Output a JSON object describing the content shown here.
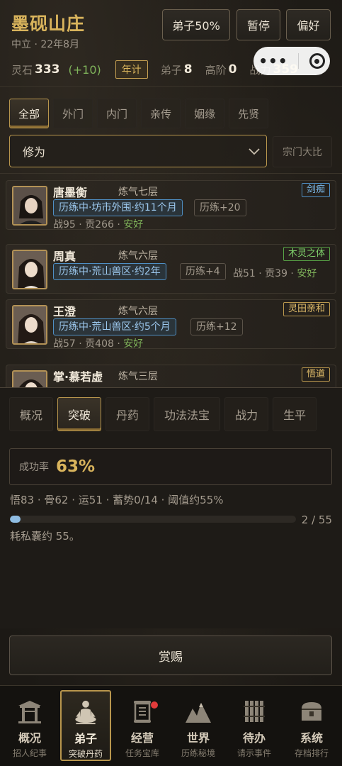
{
  "header": {
    "sect_name": "墨砚山庄",
    "subtitle": "中立 · 22年8月",
    "buttons": {
      "disciple_pct": "弟子50%",
      "pause": "暂停",
      "prefs": "偏好"
    },
    "resources": {
      "spirit_stone_label": "灵石",
      "spirit_stone_value": "333",
      "income": "(+10)",
      "yearly_btn": "年计",
      "disciple_label": "弟子",
      "disciple_value": "8",
      "senior_label": "高阶",
      "senior_value": "0",
      "power_label": "战力",
      "power_value": "359"
    },
    "capsule": {
      "more_icon": "more-dots-icon",
      "close_icon": "target-close-icon"
    }
  },
  "filter_tabs": [
    "全部",
    "外门",
    "内门",
    "亲传",
    "姻缘",
    "先贤"
  ],
  "filter_active": 0,
  "sort": {
    "value": "修为",
    "compare_btn": "宗门大比"
  },
  "disciples": [
    {
      "name": "唐墨衡",
      "realm": "炼气七层",
      "trait": "剑痴",
      "trait_color": "#7ab8e8",
      "status": "历练中·坊市外围·约11个月",
      "train": "历练+20",
      "stats": "战95 · 贡266 · ",
      "mood": "安好"
    },
    {
      "name": "周真",
      "realm": "炼气六层",
      "trait": "木灵之体",
      "trait_color": "#7fcf6a",
      "status": "历练中·荒山兽区·约2年",
      "train": "历练+4",
      "stats": "战51 · 贡39 · ",
      "mood": "安好"
    },
    {
      "name": "王澄",
      "realm": "炼气六层",
      "trait": "灵田亲和",
      "trait_color": "#e2bd6a",
      "status": "历练中·荒山兽区·约5个月",
      "train": "历练+12",
      "stats": "战57 · 贡408 · ",
      "mood": "安好"
    },
    {
      "name": "掌·慕若虚",
      "realm": "炼气三层",
      "trait": "悟道",
      "trait_color": "#e2bd6a"
    }
  ],
  "detail_tabs": [
    "概况",
    "突破",
    "丹药",
    "功法法宝",
    "战力",
    "生平"
  ],
  "detail_active": 1,
  "breakthrough": {
    "rate_label": "成功率",
    "rate_value": "63%",
    "attrs": "悟83 · 骨62 · 运51 · 蓄势0/14 · 阈值约55%",
    "progress_current": 2,
    "progress_max": 55,
    "progress_text": "2 / 55",
    "cost": "耗私囊约 55。"
  },
  "reward_button": "赏赐",
  "nav": [
    {
      "label": "概况",
      "sub": "招人纪事",
      "icon": "gate-icon"
    },
    {
      "label": "弟子",
      "sub": "突破丹药",
      "icon": "meditation-icon"
    },
    {
      "label": "经营",
      "sub": "任务宝库",
      "icon": "scroll-icon",
      "badge": true
    },
    {
      "label": "世界",
      "sub": "历练秘境",
      "icon": "mountain-icon"
    },
    {
      "label": "待办",
      "sub": "请示事件",
      "icon": "bamboo-slips-icon"
    },
    {
      "label": "系统",
      "sub": "存档排行",
      "icon": "chest-icon"
    }
  ],
  "nav_active": 1
}
